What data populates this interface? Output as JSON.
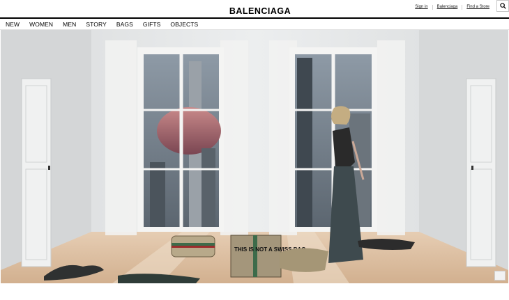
{
  "header": {
    "logo": "BALENCIAGA",
    "links": [
      "Sign in",
      "Balenciaga",
      "Find a Store"
    ],
    "search_icon": "search-icon"
  },
  "nav": {
    "items": [
      "NEW",
      "WOMEN",
      "MEN",
      "STORY",
      "BAGS",
      "GIFTS",
      "OBJECTS"
    ]
  },
  "hero": {
    "bag_text": "THIS IS NOT A SWISS BAG"
  }
}
